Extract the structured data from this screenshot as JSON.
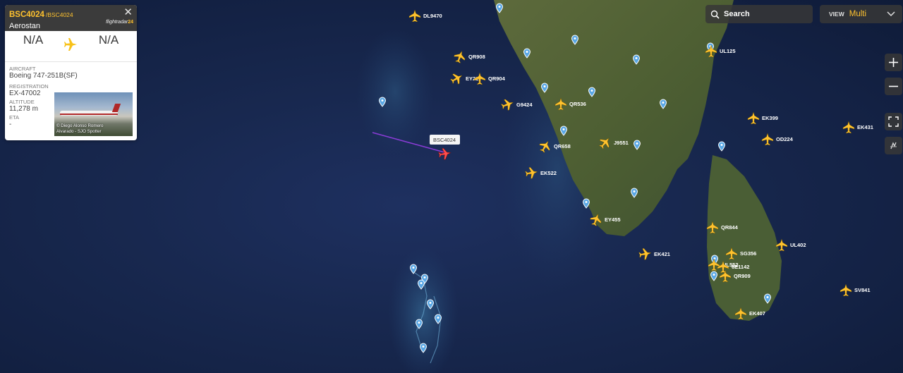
{
  "flight_panel": {
    "callsign": "BSC4024",
    "callsign_secondary": "/BSC4024",
    "airline": "Aerostan",
    "logo_text": "flightradar",
    "logo_num": "24",
    "origin": "N/A",
    "destination": "N/A",
    "aircraft_label": "AIRCRAFT",
    "aircraft": "Boeing 747-251B(SF)",
    "registration_label": "REGISTRATION",
    "registration": "EX-47002",
    "altitude_label": "ALTITUDE",
    "altitude": "11,278 m",
    "eta_label": "ETA",
    "eta": "-",
    "photo_credit_1": "© Diego Alonso Romero",
    "photo_credit_2": "Alvarado - SJO Spotter"
  },
  "search": {
    "label": "Search"
  },
  "view": {
    "label": "VIEW",
    "value": "Multi"
  },
  "selected_flight": {
    "label": "BSC4024"
  },
  "aircraft": [
    {
      "label": "DL9470"
    },
    {
      "label": "QR908"
    },
    {
      "label": "EY227"
    },
    {
      "label": "QR904"
    },
    {
      "label": "G9424"
    },
    {
      "label": "QR536"
    },
    {
      "label": "J9551"
    },
    {
      "label": "QR658"
    },
    {
      "label": "EK522"
    },
    {
      "label": "EY455"
    },
    {
      "label": "UL125"
    },
    {
      "label": "EK399"
    },
    {
      "label": "OD224"
    },
    {
      "label": "EK431"
    },
    {
      "label": "QR844"
    },
    {
      "label": "EK421"
    },
    {
      "label": "UL402"
    },
    {
      "label": "SG356"
    },
    {
      "label": "UL552"
    },
    {
      "label": "QR909"
    },
    {
      "label": "SV841"
    },
    {
      "label": "EK407"
    },
    {
      "label": "6E1142"
    }
  ],
  "colors": {
    "accent": "#ffc22e",
    "selected": "#ff4d4d",
    "trail": "#8a3cd6",
    "marker": "#5aa8e6"
  },
  "icons": [
    "search-icon",
    "chevron-down-icon",
    "zoom-in-icon",
    "zoom-out-icon",
    "fullscreen-icon",
    "weather-icon",
    "close-icon",
    "airplane-icon",
    "location-pin-icon"
  ]
}
